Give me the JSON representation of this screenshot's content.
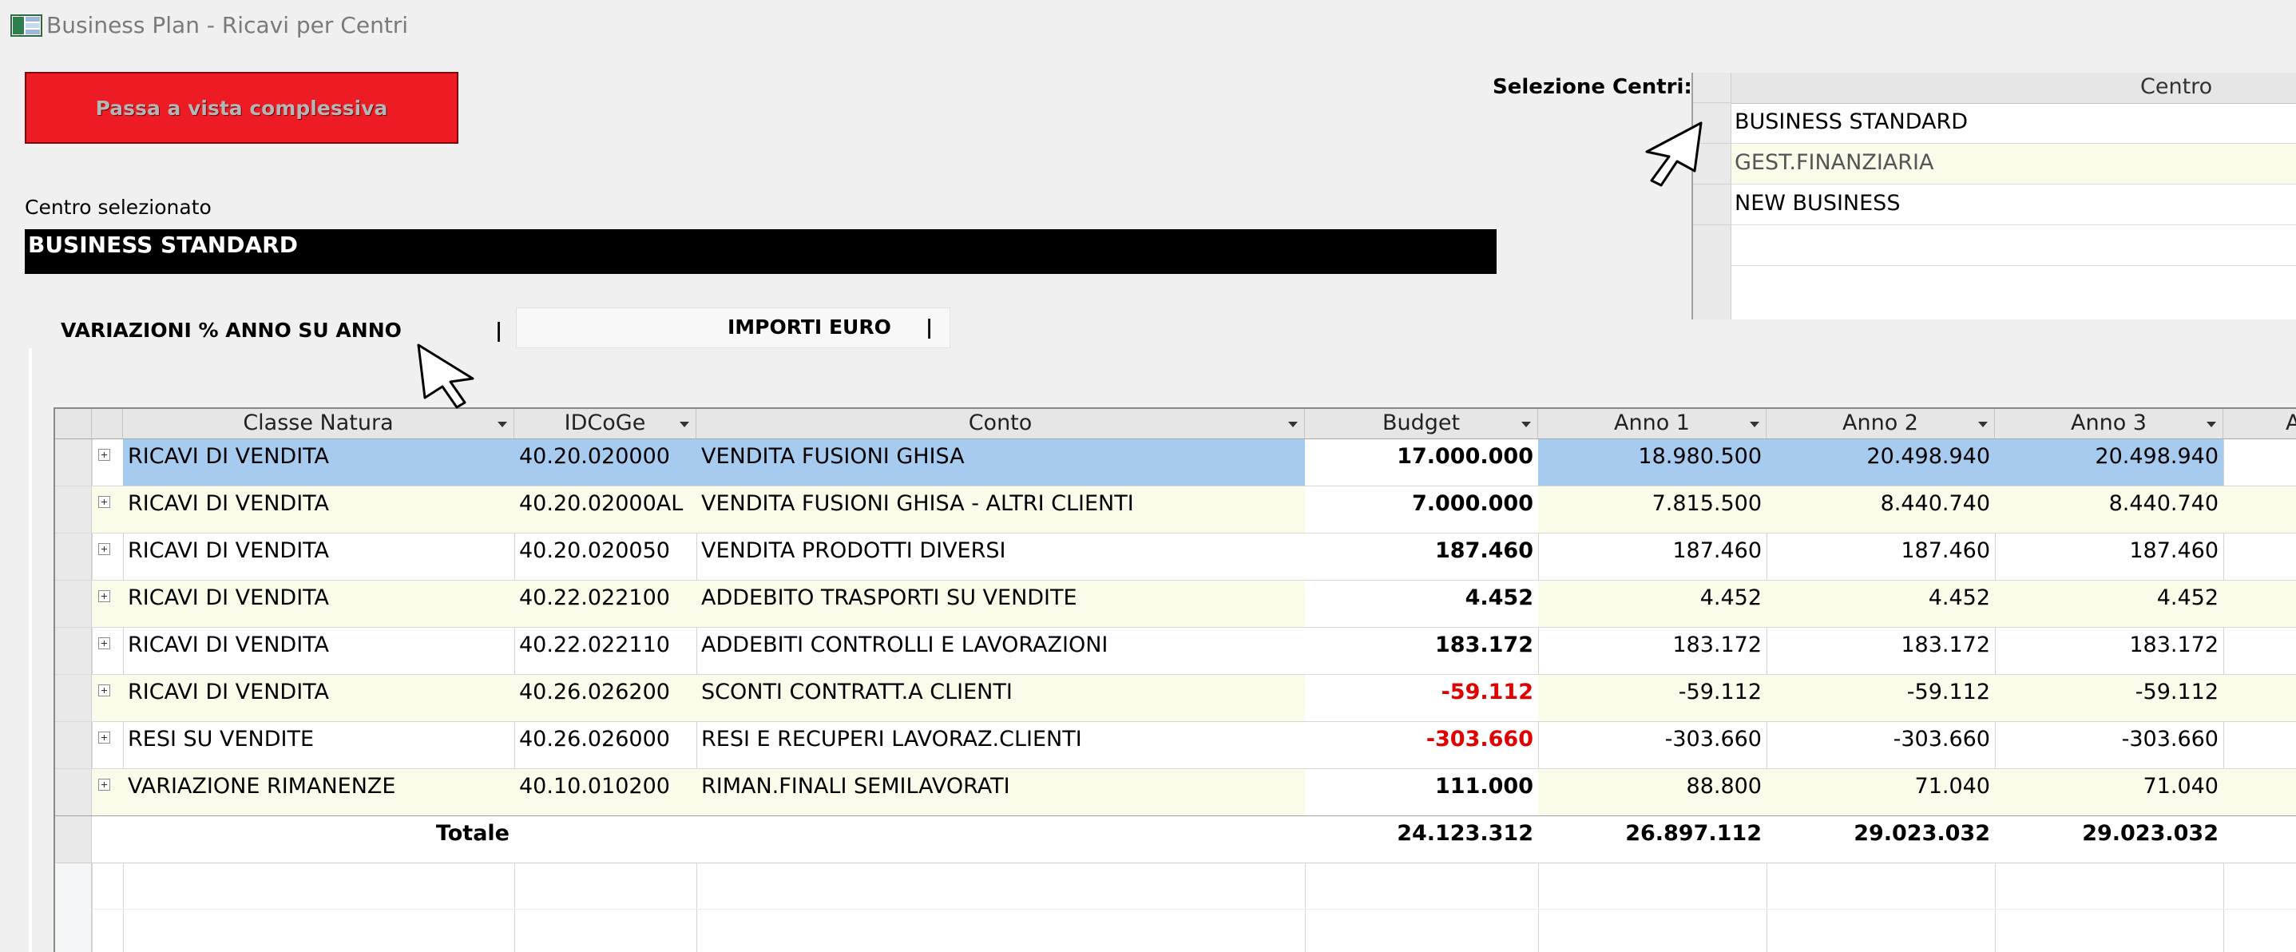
{
  "window": {
    "title": "Business Plan - Ricavi per Centri",
    "icon": "table-app-icon"
  },
  "toolbar": {
    "switch_view_label": "Passa a vista complessiva"
  },
  "selected_center": {
    "label": "Centro selezionato",
    "value": "BUSINESS STANDARD"
  },
  "centri": {
    "label": "Selezione Centri:",
    "column": "Centro",
    "items": [
      "BUSINESS STANDARD",
      "GEST.FINANZIARIA",
      "NEW BUSINESS"
    ]
  },
  "tabs": [
    {
      "label": "VARIAZIONI % ANNO SU ANNO",
      "sep": "|"
    },
    {
      "label": "IMPORTI EURO",
      "sep": "|"
    }
  ],
  "grid": {
    "columns": [
      "Classe Natura",
      "IDCoGe",
      "Conto",
      "Budget",
      "Anno 1",
      "Anno 2",
      "Anno 3",
      "A"
    ],
    "rows": [
      {
        "classe": "RICAVI DI VENDITA",
        "id": "40.20.020000",
        "conto": "VENDITA FUSIONI GHISA",
        "budget": "17.000.000",
        "a1": "18.980.500",
        "a2": "20.498.940",
        "a3": "20.498.940"
      },
      {
        "classe": "RICAVI DI VENDITA",
        "id": "40.20.02000AL",
        "conto": "VENDITA FUSIONI GHISA - ALTRI CLIENTI",
        "budget": "7.000.000",
        "a1": "7.815.500",
        "a2": "8.440.740",
        "a3": "8.440.740"
      },
      {
        "classe": "RICAVI DI VENDITA",
        "id": "40.20.020050",
        "conto": "VENDITA PRODOTTI DIVERSI",
        "budget": "187.460",
        "a1": "187.460",
        "a2": "187.460",
        "a3": "187.460"
      },
      {
        "classe": "RICAVI DI VENDITA",
        "id": "40.22.022100",
        "conto": "ADDEBITO TRASPORTI SU VENDITE",
        "budget": "4.452",
        "a1": "4.452",
        "a2": "4.452",
        "a3": "4.452"
      },
      {
        "classe": "RICAVI DI VENDITA",
        "id": "40.22.022110",
        "conto": "ADDEBITI CONTROLLI E LAVORAZIONI",
        "budget": "183.172",
        "a1": "183.172",
        "a2": "183.172",
        "a3": "183.172"
      },
      {
        "classe": "RICAVI DI VENDITA",
        "id": "40.26.026200",
        "conto": "SCONTI CONTRATT.A CLIENTI",
        "budget": "-59.112",
        "a1": "-59.112",
        "a2": "-59.112",
        "a3": "-59.112"
      },
      {
        "classe": "RESI SU VENDITE",
        "id": "40.26.026000",
        "conto": "RESI E RECUPERI LAVORAZ.CLIENTI",
        "budget": "-303.660",
        "a1": "-303.660",
        "a2": "-303.660",
        "a3": "-303.660"
      },
      {
        "classe": "VARIAZIONE RIMANENZE",
        "id": "40.10.010200",
        "conto": "RIMAN.FINALI SEMILAVORATI",
        "budget": "111.000",
        "a1": "88.800",
        "a2": "71.040",
        "a3": "71.040"
      }
    ],
    "totals": {
      "label": "Totale",
      "budget": "24.123.312",
      "a1": "26.897.112",
      "a2": "29.023.032",
      "a3": "29.023.032"
    }
  },
  "colors": {
    "accent_red": "#ed1c24",
    "selection_blue": "#a6cbee",
    "alt_row": "#fbfbea",
    "negative": "#e00000"
  }
}
